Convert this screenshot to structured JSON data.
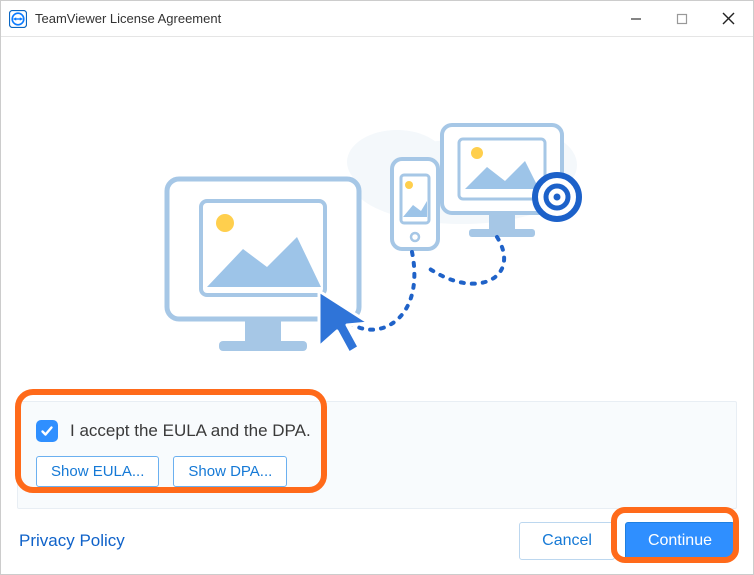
{
  "window": {
    "title": "TeamViewer License Agreement"
  },
  "agreement": {
    "checked": true,
    "label": "I accept the EULA and the DPA.",
    "show_eula_label": "Show EULA...",
    "show_dpa_label": "Show DPA..."
  },
  "footer": {
    "privacy_label": "Privacy Policy",
    "cancel_label": "Cancel",
    "continue_label": "Continue"
  },
  "colors": {
    "accent": "#2f8fff",
    "highlight": "#ff6a1a"
  }
}
